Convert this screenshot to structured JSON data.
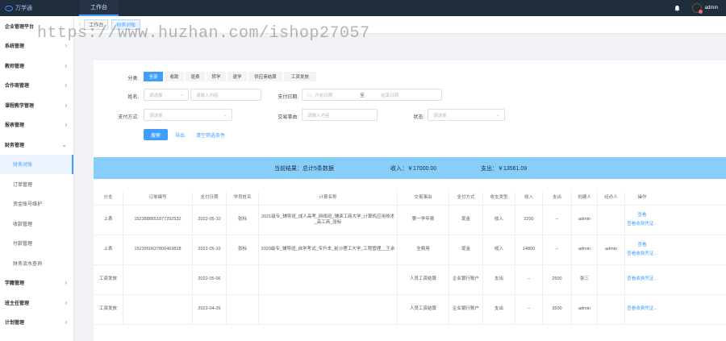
{
  "app": {
    "logo_text": "万学通"
  },
  "topbar": {
    "tab_label": "工作台",
    "user_name": "admin"
  },
  "breadcrumb": {
    "items": [
      "工作台",
      "财务对账"
    ]
  },
  "watermark": "https://www.huzhan.com/ishop27057",
  "sidebar": {
    "items": [
      {
        "label": "企业管理平台",
        "chev": ""
      },
      {
        "label": "系统管理",
        "chev": "›"
      },
      {
        "label": "教师管理",
        "chev": "›"
      },
      {
        "label": "合作商管理",
        "chev": "›"
      },
      {
        "label": "课程教学管理",
        "chev": "›"
      },
      {
        "label": "报表管理",
        "chev": "›"
      },
      {
        "label": "财务管理",
        "chev": "⌄"
      }
    ],
    "subitems": [
      "财务对账",
      "订单管理",
      "资金账号维护",
      "收款管理",
      "付款管理",
      "财务流水查询"
    ],
    "bottom_items": [
      {
        "label": "学籍管理",
        "chev": "›"
      },
      {
        "label": "班主任管理",
        "chev": "›"
      },
      {
        "label": "计划管理",
        "chev": "›"
      }
    ]
  },
  "filters": {
    "category_label": "分类:",
    "tabs": [
      "全部",
      "收款",
      "退费",
      "转学",
      "退学",
      "供应商结算",
      "工资发放"
    ],
    "name_label": "姓名:",
    "name_select_placeholder": "请选择",
    "name_input_placeholder": "请输入内容",
    "pay_date_label": "支付日期:",
    "date_start_placeholder": "开始日期",
    "date_sep": "至",
    "date_end_placeholder": "结束日期",
    "pay_method_label": "支付方式:",
    "pay_method_placeholder": "请选择",
    "trade_label": "交易事由:",
    "trade_placeholder": "请输入内容",
    "status_label": "状态:",
    "status_placeholder": "请选择",
    "search_button": "搜索",
    "export_button": "导出",
    "clear_button": "清空筛选条件"
  },
  "summary": {
    "result_text": "当前结果：总计5条数据",
    "income_text": "收入：￥17000.00",
    "expense_text": "支出：￥13561.09"
  },
  "table": {
    "headers": [
      "分支",
      "订单编号",
      "支付日期",
      "学员姓名",
      "计算名称",
      "交易事由",
      "支付方式",
      "收支类型",
      "收入",
      "支出",
      "创建人",
      "经办人",
      "操作"
    ],
    "rows": [
      {
        "branch": "上表",
        "order_no": "1523888651877292532",
        "date": "2022-05-10",
        "student": "张标",
        "name": "2021级专_辅导班_成人高考_网络班_辅读工商大学_计算机应用技术_高工商_张标",
        "reason": "第一学年费",
        "method": "现金",
        "type": "收入",
        "income": "2200",
        "expense": "--",
        "creator": "admin",
        "handler": "",
        "ops": [
          "查看",
          "查看收费凭证..."
        ]
      },
      {
        "branch": "上表",
        "order_no": "1523950637806469828",
        "date": "2022-05-10",
        "student": "张标",
        "name": "2020级专_辅导班_自学考试_专升本_前沙理工大学_工程管理__王余",
        "reason": "全费用",
        "method": "现金",
        "type": "收入",
        "income": "14800",
        "expense": "--",
        "creator": "admin",
        "handler": "admin",
        "ops": [
          "查看",
          "查看收费凭证..."
        ]
      },
      {
        "branch": "工资发放",
        "order_no": "",
        "date": "2022-05-06",
        "student": "",
        "name": "",
        "reason": "人员工资结算",
        "method": "企业银行账户",
        "type": "支出",
        "income": "--",
        "expense": "2500",
        "creator": "张三",
        "handler": "",
        "ops": [
          "查看收费凭证..."
        ]
      },
      {
        "branch": "工资发放",
        "order_no": "",
        "date": "2022-04-26",
        "student": "",
        "name": "",
        "reason": "人员工资结算",
        "method": "企业银行账户",
        "type": "支出",
        "income": "--",
        "expense": "3500",
        "creator": "admin",
        "handler": "",
        "ops": [
          "查看收费凭证..."
        ]
      }
    ]
  },
  "colors": {
    "accent": "#409eff",
    "summary_bg": "#87cefa",
    "topbar_bg": "#1f2d3d"
  }
}
